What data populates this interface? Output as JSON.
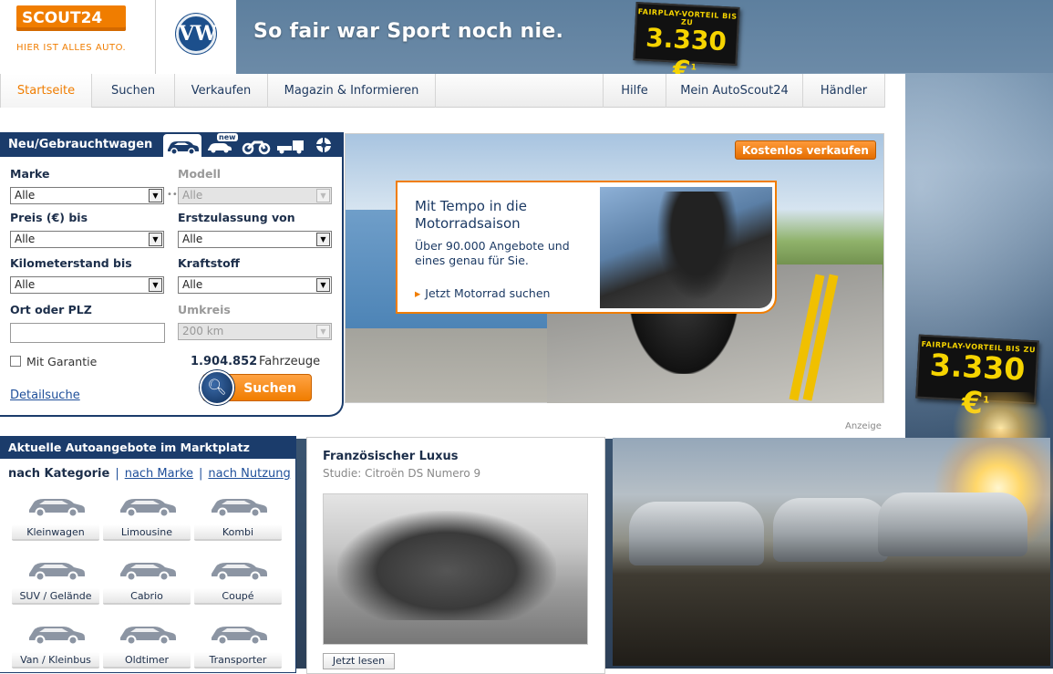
{
  "brand": {
    "logo": "SCOUT24",
    "tagline": "HIER IST ALLES AUTO."
  },
  "banner": {
    "vw_logo_text": "VW",
    "slogan": "So fair war Sport noch nie.",
    "badge_small": "FAIRPLAY-VORTEIL BIS ZU",
    "badge_value": "3.330 €",
    "badge_sup": "1"
  },
  "nav": {
    "items": [
      "Startseite",
      "Suchen",
      "Verkaufen",
      "Magazin & Informieren"
    ],
    "right_items": [
      "Hilfe",
      "Mein AutoScout24",
      "Händler"
    ]
  },
  "search": {
    "title": "Neu/Gebrauchtwagen",
    "vehicle_tab_new": "new",
    "marke_label": "Marke",
    "marke_value": "Alle",
    "modell_label": "Modell",
    "modell_value": "Alle",
    "preis_label": "Preis (€) bis",
    "preis_value": "Alle",
    "erstzulassung_label": "Erstzulassung von",
    "erstzulassung_value": "Alle",
    "km_label": "Kilometerstand bis",
    "km_value": "Alle",
    "kraftstoff_label": "Kraftstoff",
    "kraftstoff_value": "Alle",
    "ort_label": "Ort oder PLZ",
    "ort_value": "",
    "umkreis_label": "Umkreis",
    "umkreis_value": "200 km",
    "garantie_label": "Mit Garantie",
    "count_number": "1.904.852",
    "count_label": "Fahrzeuge",
    "detail_link": "Detailsuche",
    "search_button": "Suchen"
  },
  "hero": {
    "sell_button": "Kostenlos verkaufen",
    "promo_title": "Mit Tempo in die Motorradsaison",
    "promo_text": "Über 90.000 Angebote und eines genau für Sie.",
    "promo_link": "Jetzt Motorrad suchen",
    "ad_label": "Anzeige"
  },
  "market": {
    "title": "Aktuelle Autoangebote im Marktplatz",
    "tab_active": "nach Kategorie",
    "tab_marke": "nach Marke",
    "tab_nutzung": "nach Nutzung",
    "categories": [
      "Kleinwagen",
      "Limousine",
      "Kombi",
      "SUV / Gelände",
      "Cabrio",
      "Coupé",
      "Van / Kleinbus",
      "Oldtimer",
      "Transporter"
    ]
  },
  "article": {
    "title": "Französischer Luxus",
    "subtitle": "Studie: Citroën DS Numero 9",
    "button": "Jetzt lesen"
  },
  "colors": {
    "accent": "#f07d00",
    "navy": "#1b3c6b",
    "link": "#1f4f9a"
  }
}
